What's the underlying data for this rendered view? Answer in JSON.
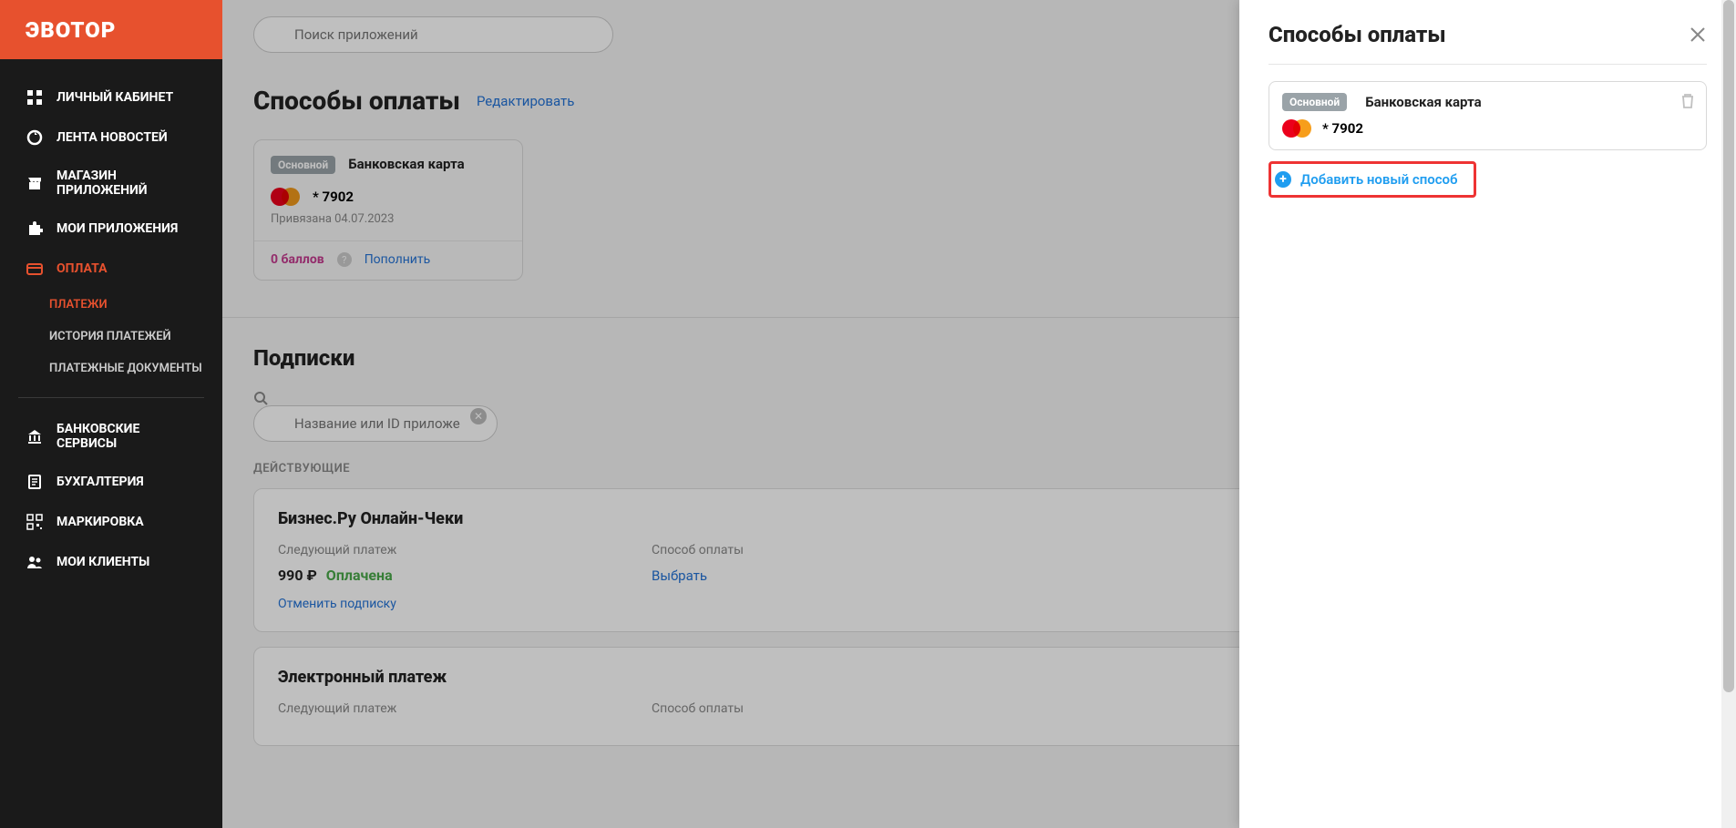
{
  "logo": "ЭВОТОР",
  "search": {
    "placeholder": "Поиск приложений"
  },
  "sidebar": {
    "items": [
      {
        "label": "ЛИЧНЫЙ КАБИНЕТ"
      },
      {
        "label": "ЛЕНТА НОВОСТЕЙ"
      },
      {
        "label": "МАГАЗИН ПРИЛОЖЕНИЙ"
      },
      {
        "label": "МОИ ПРИЛОЖЕНИЯ"
      },
      {
        "label": "ОПЛАТА"
      },
      {
        "label": "БАНКОВСКИЕ СЕРВИСЫ"
      },
      {
        "label": "БУХГАЛТЕРИЯ"
      },
      {
        "label": "МАРКИРОВКА"
      },
      {
        "label": "МОИ КЛИЕНТЫ"
      }
    ],
    "sub": [
      {
        "label": "ПЛАТЕЖИ"
      },
      {
        "label": "ИСТОРИЯ ПЛАТЕЖЕЙ"
      },
      {
        "label": "ПЛАТЕЖНЫЕ ДОКУМЕНТЫ"
      }
    ]
  },
  "page": {
    "title": "Способы оплаты",
    "edit": "Редактировать"
  },
  "card": {
    "badge": "Основной",
    "type": "Банковская карта",
    "mask": "* 7902",
    "bound": "Привязана 04.07.2023",
    "points": "0 баллов",
    "refill": "Пополнить"
  },
  "subs": {
    "title": "Подписки",
    "search_placeholder": "Название или ID приложения",
    "active_label": "ДЕЙСТВУЮЩИЕ",
    "items": [
      {
        "name": "Бизнес.Ру Онлайн-Чеки",
        "next_label": "Следующий платеж",
        "price": "990 ₽",
        "status": "Оплачена",
        "cancel": "Отменить подписку",
        "method_label": "Способ оплаты",
        "choose": "Выбрать"
      },
      {
        "name": "Электронный платеж",
        "next_label": "Следующий платеж",
        "method_label": "Способ оплаты"
      }
    ]
  },
  "drawer": {
    "title": "Способы оплаты",
    "badge": "Основной",
    "type": "Банковская карта",
    "mask": "* 7902",
    "add": "Добавить новый способ"
  }
}
